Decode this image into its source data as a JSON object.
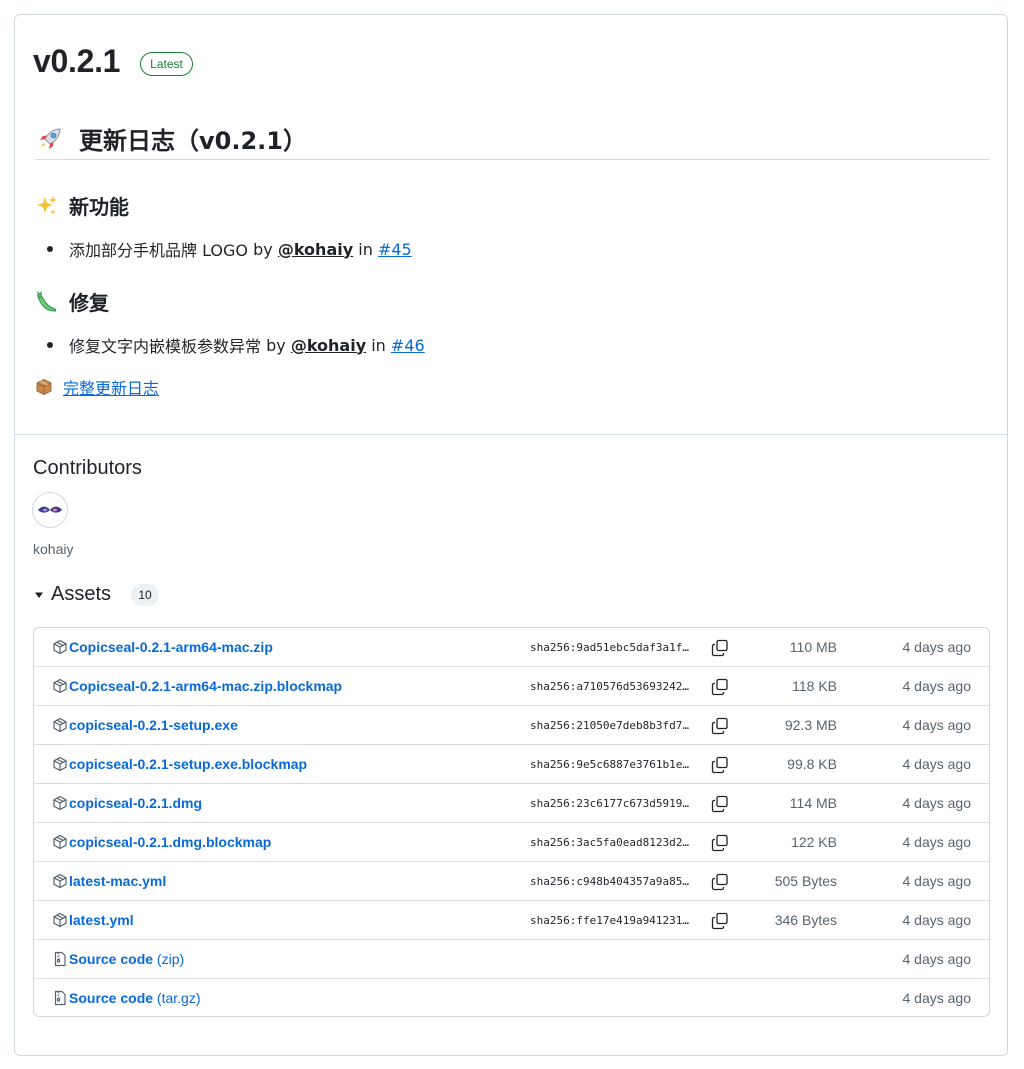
{
  "release": {
    "title": "v0.2.1",
    "badge": "Latest"
  },
  "notes": {
    "heading": "更新日志（v0.2.1）",
    "heading_icon": "rocket-icon",
    "features": {
      "heading": "新功能",
      "icon": "sparkles-icon",
      "items": [
        {
          "text": "添加部分手机品牌 LOGO",
          "by": "by",
          "user": "@kohaiy",
          "in": "in",
          "issue": "#45"
        }
      ]
    },
    "fixes": {
      "heading": "修复",
      "icon": "bug-icon",
      "items": [
        {
          "text": "修复文字内嵌模板参数异常",
          "by": "by",
          "user": "@kohaiy",
          "in": "in",
          "issue": "#46"
        }
      ]
    },
    "changelog": {
      "icon": "package-icon",
      "label": "完整更新日志"
    }
  },
  "contributors": {
    "heading": "Contributors",
    "people": [
      {
        "name": "kohaiy",
        "avatar": "avatar-kohaiy"
      }
    ]
  },
  "assets": {
    "heading": "Assets",
    "count": "10",
    "rows": [
      {
        "name": "Copicseal-0.2.1-arm64-mac.zip",
        "paren": "",
        "sha": "sha256:9ad51ebc5daf3a1f…",
        "size": "110 MB",
        "date": "4 days ago",
        "kind": "package"
      },
      {
        "name": "Copicseal-0.2.1-arm64-mac.zip.blockmap",
        "paren": "",
        "sha": "sha256:a710576d53693242…",
        "size": "118 KB",
        "date": "4 days ago",
        "kind": "package"
      },
      {
        "name": "copicseal-0.2.1-setup.exe",
        "paren": "",
        "sha": "sha256:21050e7deb8b3fd7…",
        "size": "92.3 MB",
        "date": "4 days ago",
        "kind": "package"
      },
      {
        "name": "copicseal-0.2.1-setup.exe.blockmap",
        "paren": "",
        "sha": "sha256:9e5c6887e3761b1e…",
        "size": "99.8 KB",
        "date": "4 days ago",
        "kind": "package"
      },
      {
        "name": "copicseal-0.2.1.dmg",
        "paren": "",
        "sha": "sha256:23c6177c673d5919…",
        "size": "114 MB",
        "date": "4 days ago",
        "kind": "package"
      },
      {
        "name": "copicseal-0.2.1.dmg.blockmap",
        "paren": "",
        "sha": "sha256:3ac5fa0ead8123d2…",
        "size": "122 KB",
        "date": "4 days ago",
        "kind": "package"
      },
      {
        "name": "latest-mac.yml",
        "paren": "",
        "sha": "sha256:c948b404357a9a85…",
        "size": "505 Bytes",
        "date": "4 days ago",
        "kind": "package"
      },
      {
        "name": "latest.yml",
        "paren": "",
        "sha": "sha256:ffe17e419a941231…",
        "size": "346 Bytes",
        "date": "4 days ago",
        "kind": "package"
      },
      {
        "name": "Source code",
        "paren": "(zip)",
        "sha": "",
        "size": "",
        "date": "4 days ago",
        "kind": "zip"
      },
      {
        "name": "Source code",
        "paren": "(tar.gz)",
        "sha": "",
        "size": "",
        "date": "4 days ago",
        "kind": "zip"
      }
    ]
  },
  "colors": {
    "link": "#0969da",
    "badge_green": "#1a7f37",
    "border": "#d0d7de",
    "muted": "#59636e"
  }
}
